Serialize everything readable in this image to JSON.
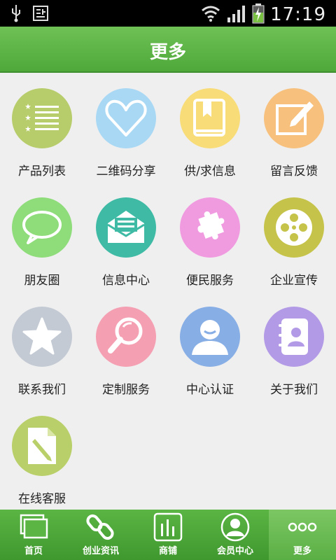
{
  "status_bar": {
    "time": "17:19"
  },
  "header": {
    "title": "更多"
  },
  "grid_items": [
    {
      "label": "产品列表",
      "icon": "list-stars-icon",
      "color": "#b7cc6a"
    },
    {
      "label": "二维码分享",
      "icon": "heart-icon",
      "color": "#a9d8f4"
    },
    {
      "label": "供/求信息",
      "icon": "book-icon",
      "color": "#f8dc78"
    },
    {
      "label": "留言反馈",
      "icon": "edit-icon",
      "color": "#f7c07c"
    },
    {
      "label": "朋友圈",
      "icon": "chat-bubble-icon",
      "color": "#8edc7a"
    },
    {
      "label": "信息中心",
      "icon": "envelope-icon",
      "color": "#3ebaa5"
    },
    {
      "label": "便民服务",
      "icon": "puzzle-icon",
      "color": "#f09ae0"
    },
    {
      "label": "企业宣传",
      "icon": "film-reel-icon",
      "color": "#c5c34a"
    },
    {
      "label": "联系我们",
      "icon": "star-icon",
      "color": "#c3cad4"
    },
    {
      "label": "定制服务",
      "icon": "magnifier-icon",
      "color": "#f49fb2"
    },
    {
      "label": "中心认证",
      "icon": "user-icon",
      "color": "#88aee6"
    },
    {
      "label": "关于我们",
      "icon": "contacts-book-icon",
      "color": "#b39ae6"
    },
    {
      "label": "在线客服",
      "icon": "document-edit-icon",
      "color": "#b9d06a"
    }
  ],
  "bottom_nav": [
    {
      "label": "首页",
      "icon": "home-windows-icon",
      "active": false
    },
    {
      "label": "创业资讯",
      "icon": "link-icon",
      "active": false
    },
    {
      "label": "商铺",
      "icon": "bar-chart-icon",
      "active": false
    },
    {
      "label": "会员中心",
      "icon": "member-icon",
      "active": false
    },
    {
      "label": "更多",
      "icon": "more-dots-icon",
      "active": true
    }
  ]
}
